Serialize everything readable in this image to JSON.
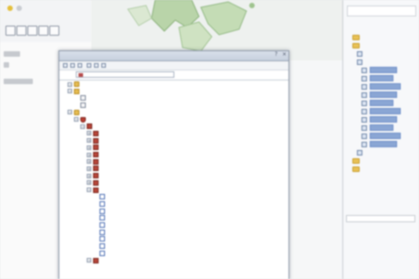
{
  "colors": {
    "dialog_border": "#8f9aaa",
    "tree_text": "#2f3e5f",
    "feature_class_text": "#3f61a8",
    "selection": "#3b66c4",
    "folder": "#e6bc52",
    "database": "#ba3f33"
  },
  "background_app": {
    "toolbar_icons": [
      "refresh-icon",
      "pencil-icon",
      "pointer-icon",
      "edit-tool-icon",
      "ruler-icon"
    ]
  },
  "catalog_panel": {
    "title": "",
    "rows": [
      {
        "icon": "folder-icon"
      },
      {
        "icon": "folder-icon"
      },
      {
        "icon": "layer-icon"
      },
      {
        "icon": "dataset-icon"
      },
      {
        "icon": "feature-class-icon"
      },
      {
        "icon": "feature-class-icon"
      },
      {
        "icon": "feature-class-icon"
      },
      {
        "icon": "feature-class-icon"
      },
      {
        "icon": "feature-class-icon"
      },
      {
        "icon": "feature-class-icon"
      },
      {
        "icon": "feature-class-icon"
      },
      {
        "icon": "feature-class-icon"
      },
      {
        "icon": "feature-class-icon"
      },
      {
        "icon": "feature-class-icon"
      },
      {
        "icon": "layer-icon"
      },
      {
        "icon": "folder-icon"
      },
      {
        "icon": "folder-icon"
      }
    ]
  },
  "dialog": {
    "controls": [
      "?",
      "×"
    ],
    "location_icon": "database-icon",
    "tree": [
      {
        "depth": 0,
        "icon": "folder"
      },
      {
        "depth": 0,
        "icon": "connection"
      },
      {
        "depth": 1,
        "icon": "file"
      },
      {
        "depth": 1,
        "icon": "file"
      },
      {
        "depth": 0,
        "icon": "folder"
      },
      {
        "depth": 1,
        "icon": "db"
      },
      {
        "depth": 2,
        "icon": "dataset"
      },
      {
        "depth": 3,
        "icon": "dataset"
      },
      {
        "depth": 3,
        "icon": "dataset"
      },
      {
        "depth": 3,
        "icon": "dataset"
      },
      {
        "depth": 3,
        "icon": "dataset"
      },
      {
        "depth": 3,
        "icon": "dataset"
      },
      {
        "depth": 3,
        "icon": "dataset"
      },
      {
        "depth": 3,
        "icon": "dataset"
      },
      {
        "depth": 3,
        "icon": "dataset"
      },
      {
        "depth": 3,
        "icon": "dataset"
      },
      {
        "depth": 4,
        "icon": "fc"
      },
      {
        "depth": 4,
        "icon": "fc"
      },
      {
        "depth": 4,
        "icon": "fc"
      },
      {
        "depth": 4,
        "icon": "fc"
      },
      {
        "depth": 4,
        "icon": "fc"
      },
      {
        "depth": 4,
        "icon": "fc"
      },
      {
        "depth": 4,
        "icon": "fc"
      },
      {
        "depth": 4,
        "icon": "fc"
      },
      {
        "depth": 4,
        "icon": "fc"
      },
      {
        "depth": 3,
        "icon": "dataset"
      }
    ]
  }
}
